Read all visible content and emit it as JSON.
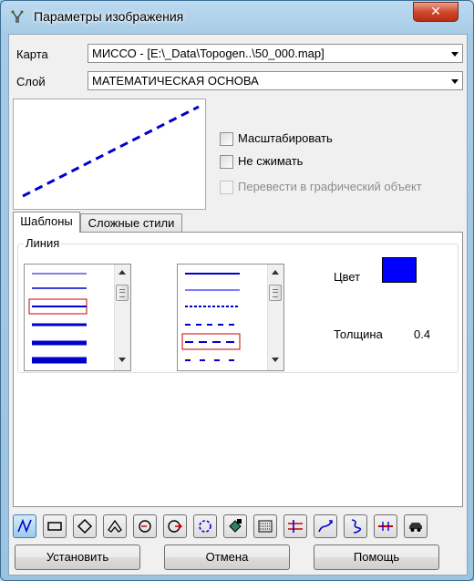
{
  "window": {
    "title": "Параметры изображения",
    "close_symbol": "✕"
  },
  "map": {
    "label": "Карта",
    "value": "МИССО - [E:\\_Data\\Topogen..\\50_000.map]"
  },
  "layer": {
    "label": "Слой",
    "value": "МАТЕМАТИЧЕСКАЯ ОСНОВА"
  },
  "options": {
    "scale": {
      "label": "Масштабировать",
      "checked": false
    },
    "no_compress": {
      "label": "Не сжимать",
      "checked": false
    },
    "convert": {
      "label": "Перевести в графический объект",
      "checked": false,
      "enabled": false
    }
  },
  "tabs": [
    {
      "label": "Шаблоны",
      "active": true
    },
    {
      "label": "Сложные стили",
      "active": false
    }
  ],
  "line_group": {
    "title": "Линия",
    "color_label": "Цвет",
    "color": "#0000ff",
    "thickness_label": "Толщина",
    "thickness_value": "0.4"
  },
  "toolbar_icons": [
    "line-icon",
    "rectangle-icon",
    "diamond-icon",
    "polygon-icon",
    "circle-icon",
    "circle-arrow-icon",
    "circle-dashed-icon",
    "fill-bucket-icon",
    "hatch-icon",
    "crossing-lines-icon",
    "curve-arrows-icon",
    "curve-icon",
    "crossed-line-icon",
    "car-icon"
  ],
  "buttons": {
    "apply": "Установить",
    "cancel": "Отмена",
    "help": "Помощь"
  }
}
